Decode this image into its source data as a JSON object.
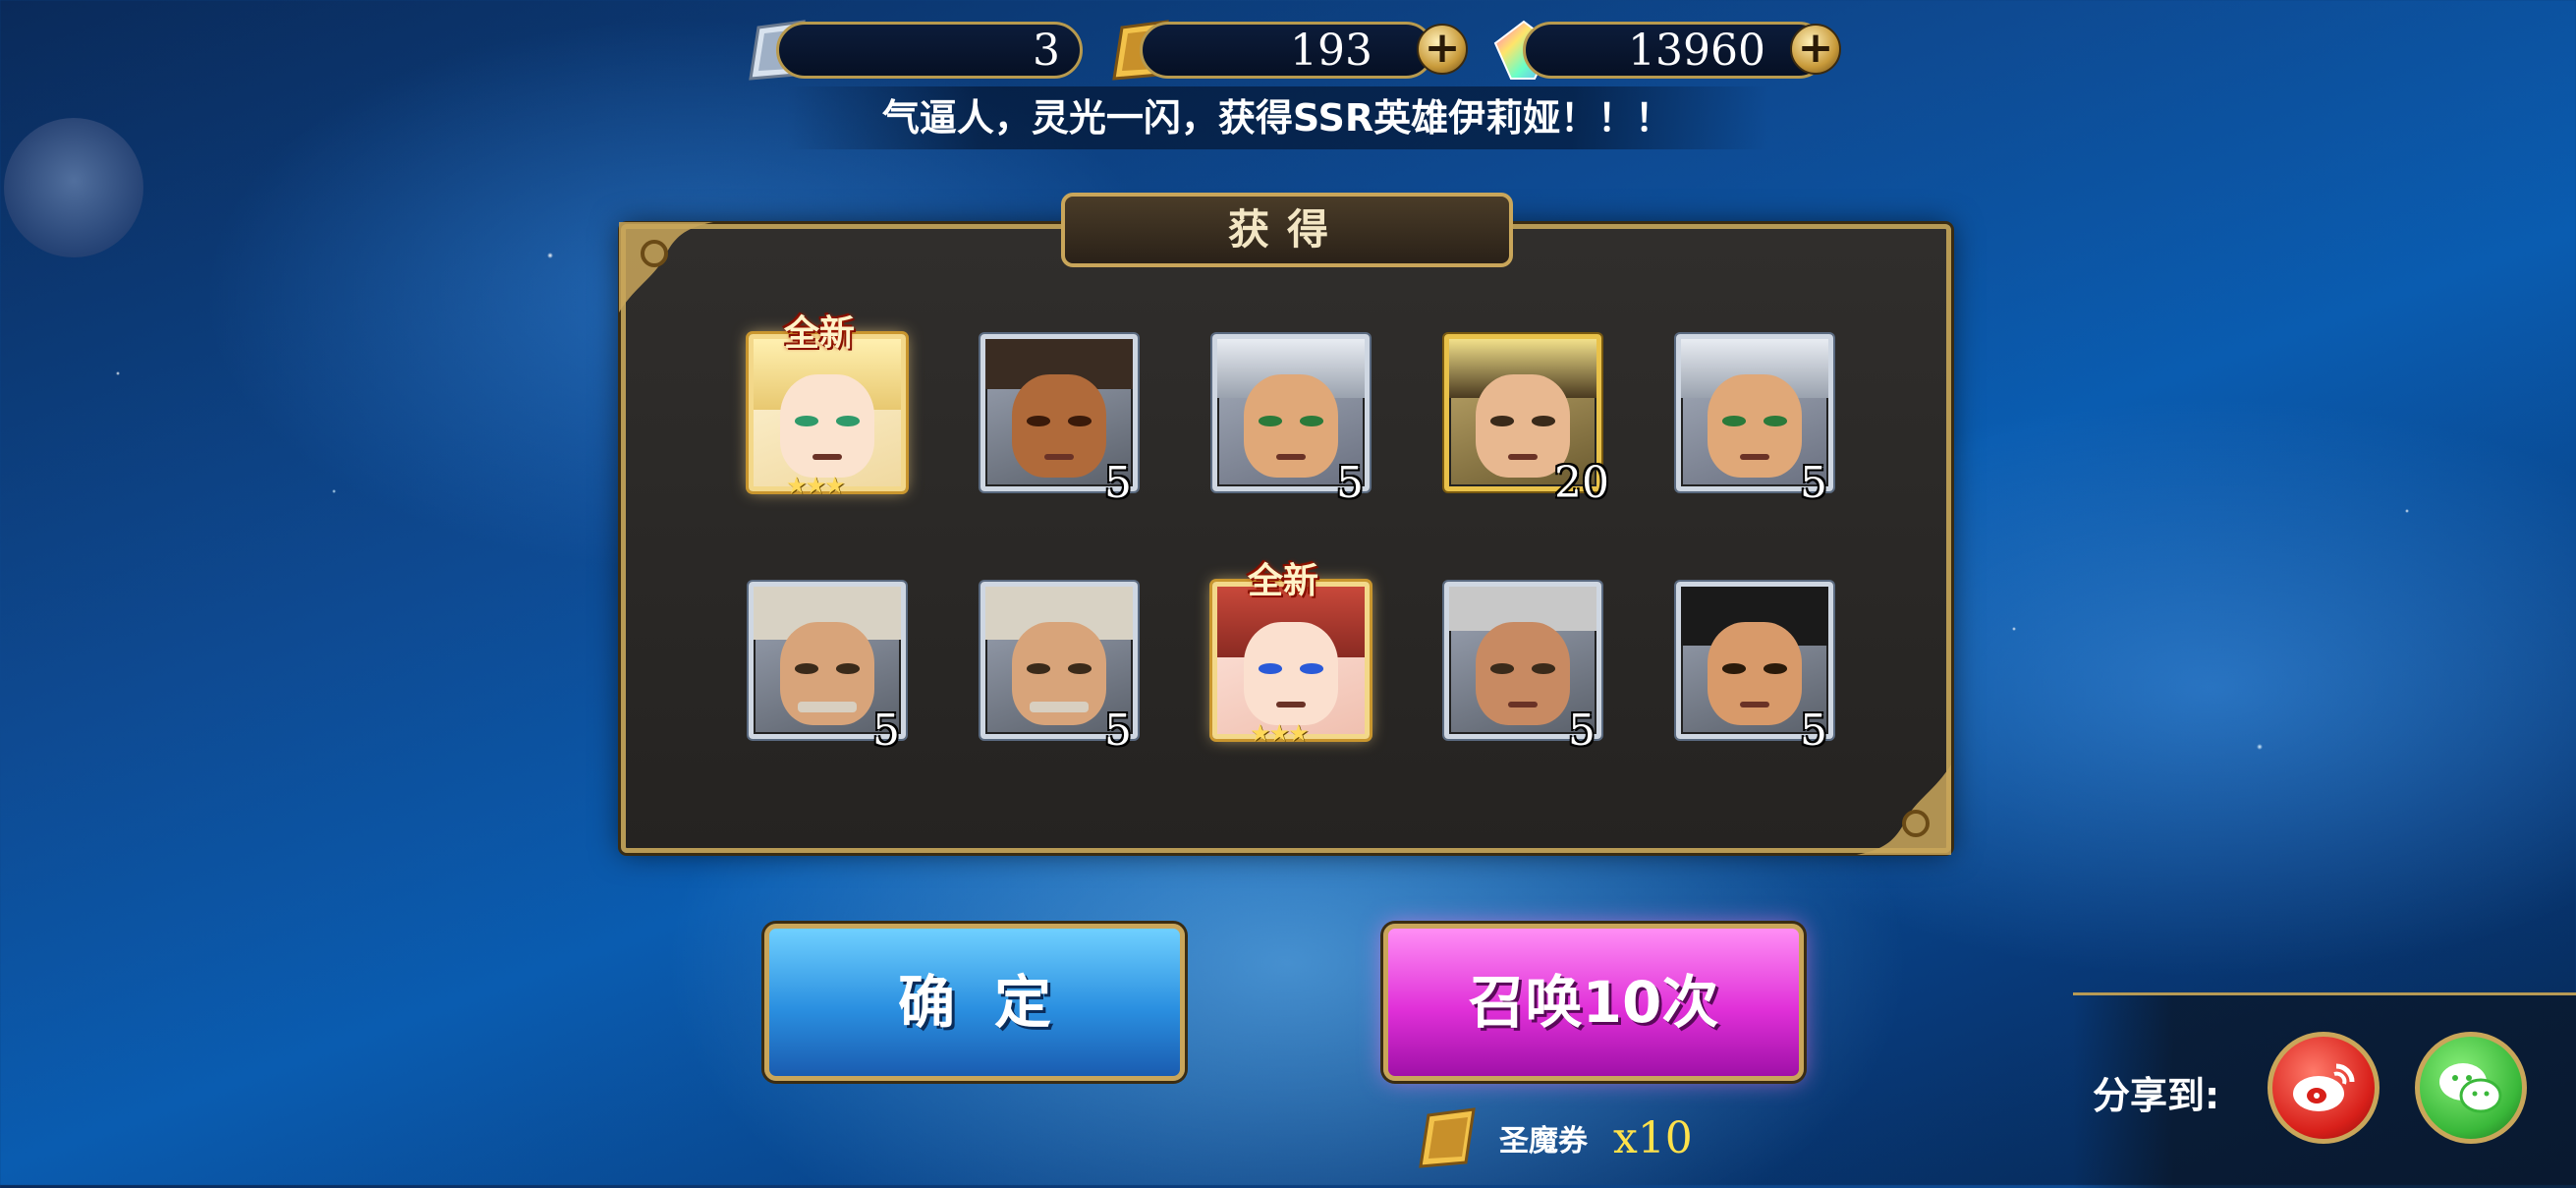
{
  "resources": {
    "tickets_silver": "3",
    "tickets_gold": "193",
    "gems": "13960",
    "plus": "+"
  },
  "notice": "气逼人，灵光一闪，获得SSR英雄伊莉娅！！！",
  "panel": {
    "title": "获得"
  },
  "heroes": [
    {
      "new_tag": "全新",
      "stars": "★★★",
      "count": ""
    },
    {
      "new_tag": "",
      "stars": "",
      "count": "5"
    },
    {
      "new_tag": "",
      "stars": "",
      "count": "5"
    },
    {
      "new_tag": "",
      "stars": "",
      "count": "20"
    },
    {
      "new_tag": "",
      "stars": "",
      "count": "5"
    },
    {
      "new_tag": "",
      "stars": "",
      "count": "5"
    },
    {
      "new_tag": "",
      "stars": "",
      "count": "5"
    },
    {
      "new_tag": "全新",
      "stars": "★★★",
      "count": ""
    },
    {
      "new_tag": "",
      "stars": "",
      "count": "5"
    },
    {
      "new_tag": "",
      "stars": "",
      "count": "5"
    }
  ],
  "buttons": {
    "confirm": "确定",
    "summon": "召唤10次"
  },
  "summon_cost": {
    "label": "圣魔券",
    "amount": "x10"
  },
  "share": {
    "label": "分享到:"
  },
  "icons": {
    "silver_ticket": "silver-ticket-icon",
    "gold_ticket": "gold-ticket-icon",
    "gem": "rainbow-gem-icon",
    "weibo": "weibo-icon",
    "wechat": "wechat-icon"
  }
}
